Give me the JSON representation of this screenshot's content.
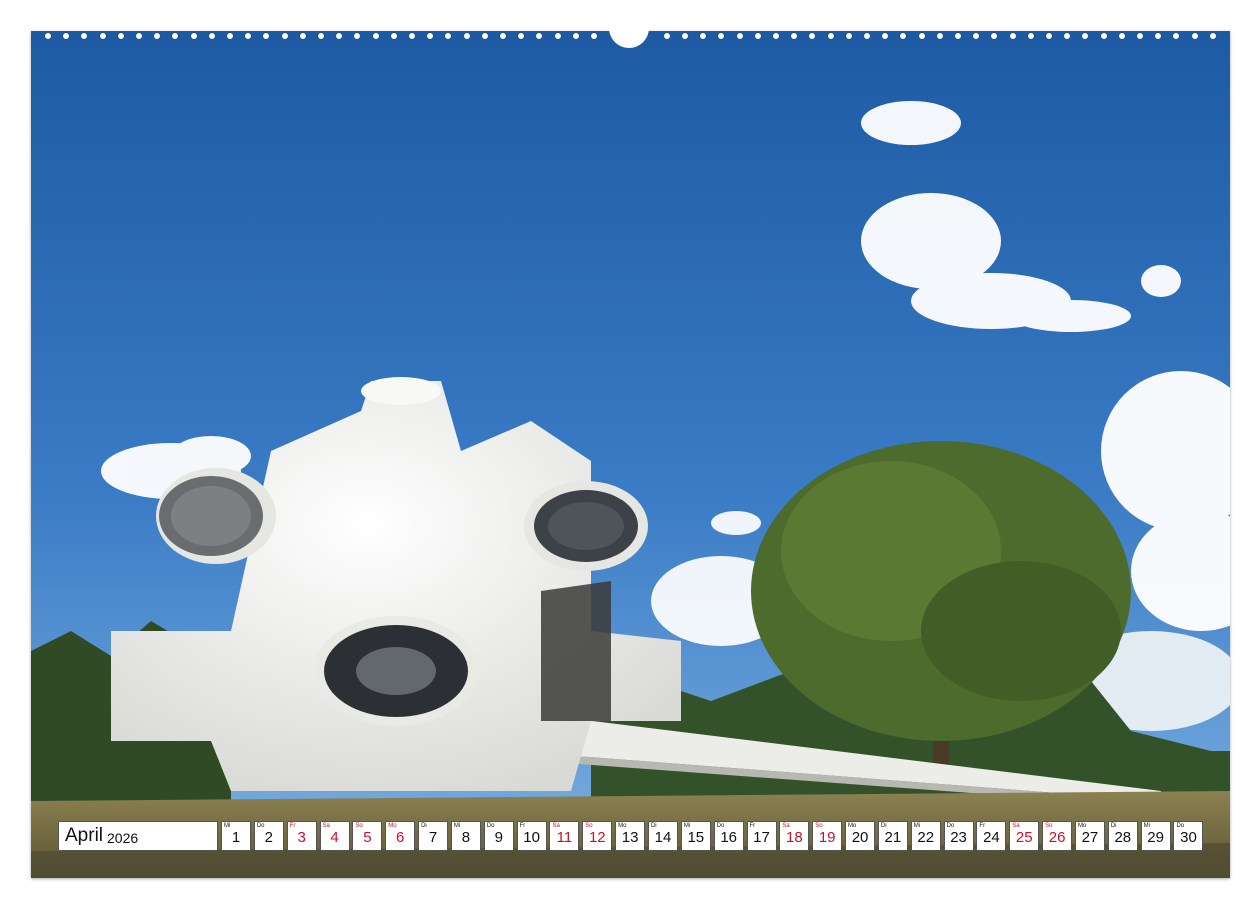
{
  "calendar": {
    "month": "April",
    "year": "2026",
    "weekend_color": "#c8102e",
    "days": [
      {
        "wd": "Mi",
        "n": "1",
        "red": false
      },
      {
        "wd": "Do",
        "n": "2",
        "red": false
      },
      {
        "wd": "Fr",
        "n": "3",
        "red": true
      },
      {
        "wd": "Sa",
        "n": "4",
        "red": true
      },
      {
        "wd": "So",
        "n": "5",
        "red": true
      },
      {
        "wd": "Mo",
        "n": "6",
        "red": true
      },
      {
        "wd": "Di",
        "n": "7",
        "red": false
      },
      {
        "wd": "Mi",
        "n": "8",
        "red": false
      },
      {
        "wd": "Do",
        "n": "9",
        "red": false
      },
      {
        "wd": "Fr",
        "n": "10",
        "red": false
      },
      {
        "wd": "Sa",
        "n": "11",
        "red": true
      },
      {
        "wd": "So",
        "n": "12",
        "red": true
      },
      {
        "wd": "Mo",
        "n": "13",
        "red": false
      },
      {
        "wd": "Di",
        "n": "14",
        "red": false
      },
      {
        "wd": "Mi",
        "n": "15",
        "red": false
      },
      {
        "wd": "Do",
        "n": "16",
        "red": false
      },
      {
        "wd": "Fr",
        "n": "17",
        "red": false
      },
      {
        "wd": "Sa",
        "n": "18",
        "red": true
      },
      {
        "wd": "So",
        "n": "19",
        "red": true
      },
      {
        "wd": "Mo",
        "n": "20",
        "red": false
      },
      {
        "wd": "Di",
        "n": "21",
        "red": false
      },
      {
        "wd": "Mi",
        "n": "22",
        "red": false
      },
      {
        "wd": "Do",
        "n": "23",
        "red": false
      },
      {
        "wd": "Fr",
        "n": "24",
        "red": false
      },
      {
        "wd": "Sa",
        "n": "25",
        "red": true
      },
      {
        "wd": "So",
        "n": "26",
        "red": true
      },
      {
        "wd": "Mo",
        "n": "27",
        "red": false
      },
      {
        "wd": "Di",
        "n": "28",
        "red": false
      },
      {
        "wd": "Mi",
        "n": "29",
        "red": false
      },
      {
        "wd": "Do",
        "n": "30",
        "red": false
      }
    ]
  },
  "colors": {
    "sky_top": "#1f5fa8",
    "sky_bottom": "#5d9ad6",
    "monument": "#f2f2f0",
    "tree": "#4f6e2c",
    "grass": "#8a7f4a"
  }
}
